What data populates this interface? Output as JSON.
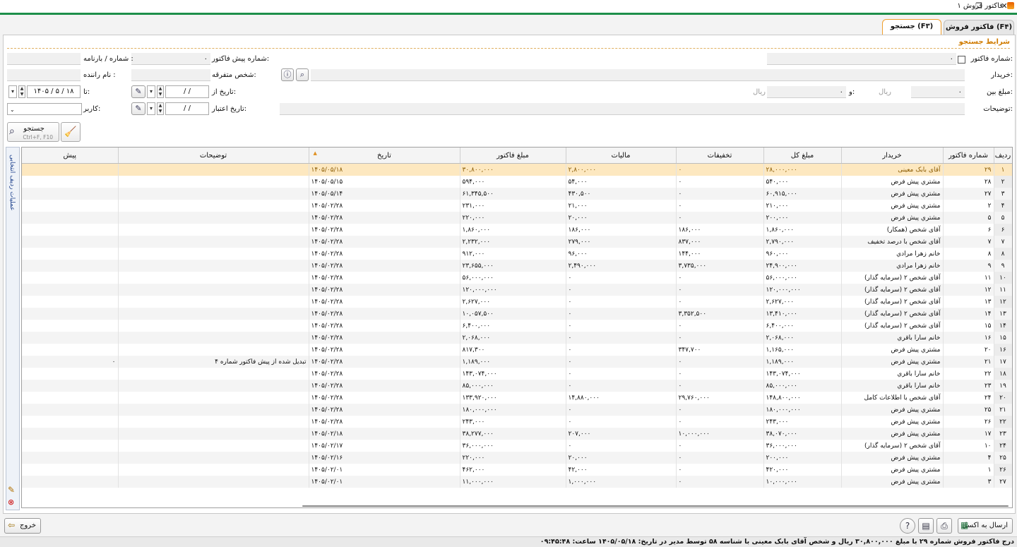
{
  "window": {
    "title": "فاکتور فروش ۱",
    "maximize_glyph": "❐",
    "close_glyph": "✕"
  },
  "tabs": [
    {
      "label": "فاکتور فروش (F۴)"
    },
    {
      "label": "جستجو (F۳)"
    }
  ],
  "section_title": "شرایط جستجو",
  "filters": {
    "invoice_no_label": "شماره فاکتور:",
    "invoice_no_value": "۰",
    "pre_invoice_no_label": "شماره پیش فاکتور:",
    "pre_invoice_no_value": "۰",
    "waybill_label": "شماره / بارنامه :",
    "buyer_label": "خریدار:",
    "misc_person_label": "شخص متفرقه:",
    "driver_label": "نام راننده :",
    "amount_between_label": "مبلغ بین:",
    "amount_from_value": "۰",
    "amount_from_unit": "ریال",
    "and_label": "و:",
    "amount_to_value": "۰",
    "amount_to_unit": "ریال",
    "date_from_label": "تاریخ از:",
    "date_from_value": "/      /",
    "date_to_label": "تا:",
    "date_to_value": "۱۴۰۵ / ۵ / ۱۸",
    "description_label": "توضیحات:",
    "validity_date_label": "تاریخ اعتبار:",
    "validity_date_value": "/      /",
    "user_label": "کاربر:"
  },
  "search_button": {
    "label": "جستجو",
    "shortcut": "Ctrl+F, F10"
  },
  "side_toolbar": {
    "label": "عملیات ردیف انتخابی"
  },
  "grid": {
    "headers": [
      "ردیف",
      "شماره فاکتور",
      "خریدار",
      "مبلغ کل",
      "تخفیفات",
      "مالیات",
      "مبلغ فاکتور",
      "تاریخ",
      "توضیحات",
      "پیش"
    ],
    "rows": [
      [
        "۱",
        "۲۹",
        "آقای بابک معینی",
        "۲۸,۰۰۰,۰۰۰",
        "۰",
        "۲,۸۰۰,۰۰۰",
        "۳۰,۸۰۰,۰۰۰",
        "۱۴۰۵/۰۵/۱۸",
        "",
        ""
      ],
      [
        "۲",
        "۲۸",
        "مشتري پیش فرض",
        "۵۴۰,۰۰۰",
        "۰",
        "۵۴,۰۰۰",
        "۵۹۴,۰۰۰",
        "۱۴۰۵/۰۵/۱۵",
        "",
        ""
      ],
      [
        "۳",
        "۲۷",
        "مشتري پیش فرض",
        "۶۰,۹۱۵,۰۰۰",
        "۰",
        "۴۳۰,۵۰۰",
        "۶۱,۳۴۵,۵۰۰",
        "۱۴۰۵/۰۵/۱۴",
        "",
        ""
      ],
      [
        "۴",
        "۲",
        "مشتري پیش فرض",
        "۲۱۰,۰۰۰",
        "۰",
        "۲۱,۰۰۰",
        "۲۳۱,۰۰۰",
        "۱۴۰۵/۰۲/۲۸",
        "",
        ""
      ],
      [
        "۵",
        "۵",
        "مشتري پیش فرض",
        "۲۰۰,۰۰۰",
        "۰",
        "۲۰,۰۰۰",
        "۲۲۰,۰۰۰",
        "۱۴۰۵/۰۲/۲۸",
        "",
        ""
      ],
      [
        "۶",
        "۶",
        "آقای شخص (همکار)",
        "۱,۸۶۰,۰۰۰",
        "۱۸۶,۰۰۰",
        "۱۸۶,۰۰۰",
        "۱,۸۶۰,۰۰۰",
        "۱۴۰۵/۰۲/۲۸",
        "",
        ""
      ],
      [
        "۷",
        "۷",
        "آقای شخص با درصد تخفیف",
        "۲,۷۹۰,۰۰۰",
        "۸۳۷,۰۰۰",
        "۲۷۹,۰۰۰",
        "۲,۲۳۲,۰۰۰",
        "۱۴۰۵/۰۲/۲۸",
        "",
        ""
      ],
      [
        "۸",
        "۸",
        "خانم زهرا مرادي",
        "۹۶۰,۰۰۰",
        "۱۴۴,۰۰۰",
        "۹۶,۰۰۰",
        "۹۱۲,۰۰۰",
        "۱۴۰۵/۰۲/۲۸",
        "",
        ""
      ],
      [
        "۹",
        "۹",
        "خانم زهرا مرادي",
        "۲۴,۹۰۰,۰۰۰",
        "۳,۷۳۵,۰۰۰",
        "۲,۴۹۰,۰۰۰",
        "۲۳,۶۵۵,۰۰۰",
        "۱۴۰۵/۰۲/۲۸",
        "",
        ""
      ],
      [
        "۱۰",
        "۱۱",
        "آقای شخص ۲ (سرمایه گذار)",
        "۵۶,۰۰۰,۰۰۰",
        "۰",
        "۰",
        "۵۶,۰۰۰,۰۰۰",
        "۱۴۰۵/۰۲/۲۸",
        "",
        ""
      ],
      [
        "۱۱",
        "۱۲",
        "آقای شخص ۲ (سرمایه گذار)",
        "۱۲۰,۰۰۰,۰۰۰",
        "۰",
        "۰",
        "۱۲۰,۰۰۰,۰۰۰",
        "۱۴۰۵/۰۲/۲۸",
        "",
        ""
      ],
      [
        "۱۲",
        "۱۳",
        "آقای شخص ۲ (سرمایه گذار)",
        "۲,۶۲۷,۰۰۰",
        "۰",
        "۰",
        "۲,۶۲۷,۰۰۰",
        "۱۴۰۵/۰۲/۲۸",
        "",
        ""
      ],
      [
        "۱۳",
        "۱۴",
        "آقای شخص ۲ (سرمایه گذار)",
        "۱۳,۴۱۰,۰۰۰",
        "۳,۳۵۲,۵۰۰",
        "۰",
        "۱۰,۰۵۷,۵۰۰",
        "۱۴۰۵/۰۲/۲۸",
        "",
        ""
      ],
      [
        "۱۴",
        "۱۵",
        "آقای شخص ۲ (سرمایه گذار)",
        "۶,۴۰۰,۰۰۰",
        "۰",
        "۰",
        "۶,۴۰۰,۰۰۰",
        "۱۴۰۵/۰۲/۲۸",
        "",
        ""
      ],
      [
        "۱۵",
        "۱۶",
        "خانم سارا باقري",
        "۲,۰۶۸,۰۰۰",
        "۰",
        "۰",
        "۲,۰۶۸,۰۰۰",
        "۱۴۰۵/۰۲/۲۸",
        "",
        ""
      ],
      [
        "۱۶",
        "۲۰",
        "مشتري پیش فرض",
        "۱,۱۶۵,۰۰۰",
        "۳۴۷,۷۰۰",
        "۰",
        "۸۱۷,۳۰۰",
        "۱۴۰۵/۰۲/۲۸",
        "",
        ""
      ],
      [
        "۱۷",
        "۲۱",
        "مشتري پیش فرض",
        "۱,۱۸۹,۰۰۰",
        "۰",
        "۰",
        "۱,۱۸۹,۰۰۰",
        "۱۴۰۵/۰۲/۲۸",
        "تبدیل شده از پیش فاکتور شماره ۴",
        "۰"
      ],
      [
        "۱۸",
        "۲۲",
        "خانم سارا باقري",
        "۱۴۳,۰۷۴,۰۰۰",
        "۰",
        "۰",
        "۱۴۳,۰۷۴,۰۰۰",
        "۱۴۰۵/۰۲/۲۸",
        "",
        ""
      ],
      [
        "۱۹",
        "۲۳",
        "خانم سارا باقري",
        "۸۵,۰۰۰,۰۰۰",
        "۰",
        "۰",
        "۸۵,۰۰۰,۰۰۰",
        "۱۴۰۵/۰۲/۲۸",
        "",
        ""
      ],
      [
        "۲۰",
        "۲۴",
        "آقای شخص با اطلاعات کامل",
        "۱۴۸,۸۰۰,۰۰۰",
        "۲۹,۷۶۰,۰۰۰",
        "۱۴,۸۸۰,۰۰۰",
        "۱۳۳,۹۲۰,۰۰۰",
        "۱۴۰۵/۰۲/۲۸",
        "",
        ""
      ],
      [
        "۲۱",
        "۲۵",
        "مشتري پیش فرض",
        "۱۸۰,۰۰۰,۰۰۰",
        "۰",
        "۰",
        "۱۸۰,۰۰۰,۰۰۰",
        "۱۴۰۵/۰۲/۲۸",
        "",
        ""
      ],
      [
        "۲۲",
        "۲۶",
        "مشتري پیش فرض",
        "۲۴۳,۰۰۰",
        "۰",
        "۰",
        "۲۴۳,۰۰۰",
        "۱۴۰۵/۰۲/۲۸",
        "",
        ""
      ],
      [
        "۲۳",
        "۱۷",
        "مشتري پیش فرض",
        "۳۸,۰۷۰,۰۰۰",
        "۱۰,۰۰۰,۰۰۰",
        "۲۰۷,۰۰۰",
        "۳۸,۲۷۷,۰۰۰",
        "۱۴۰۵/۰۲/۱۸",
        "",
        ""
      ],
      [
        "۲۴",
        "۱۰",
        "آقای شخص ۲ (سرمایه گذار)",
        "۳۶,۰۰۰,۰۰۰",
        "۰",
        "۰",
        "۳۶,۰۰۰,۰۰۰",
        "۱۴۰۵/۰۲/۱۷",
        "",
        ""
      ],
      [
        "۲۵",
        "۴",
        "مشتري پیش فرض",
        "۲۰۰,۰۰۰",
        "۰",
        "۲۰,۰۰۰",
        "۲۲۰,۰۰۰",
        "۱۴۰۵/۰۲/۱۶",
        "",
        ""
      ],
      [
        "۲۶",
        "۱",
        "مشتري پیش فرض",
        "۴۲۰,۰۰۰",
        "۰",
        "۴۲,۰۰۰",
        "۴۶۲,۰۰۰",
        "۱۴۰۵/۰۲/۰۱",
        "",
        ""
      ],
      [
        "۲۷",
        "۳",
        "مشتری پیش فرض",
        "۱۰,۰۰۰,۰۰۰",
        "۰",
        "۱,۰۰۰,۰۰۰",
        "۱۱,۰۰۰,۰۰۰",
        "۱۴۰۵/۰۲/۰۱",
        "",
        ""
      ]
    ]
  },
  "bottom": {
    "exit_label": "خروج",
    "excel_label": "ارسال به اکسل"
  },
  "status_text": "درج فاکتور فروش شماره ۲۹ با مبلغ ۳۰,۸۰۰,۰۰۰ ریال و شخص آقای بابک معینی با شناسه ۵۸ توسط مدیر در تاریخ: ۱۴۰۵/۰۵/۱۸ ساعت: ۰۹:۴۵:۴۸"
}
